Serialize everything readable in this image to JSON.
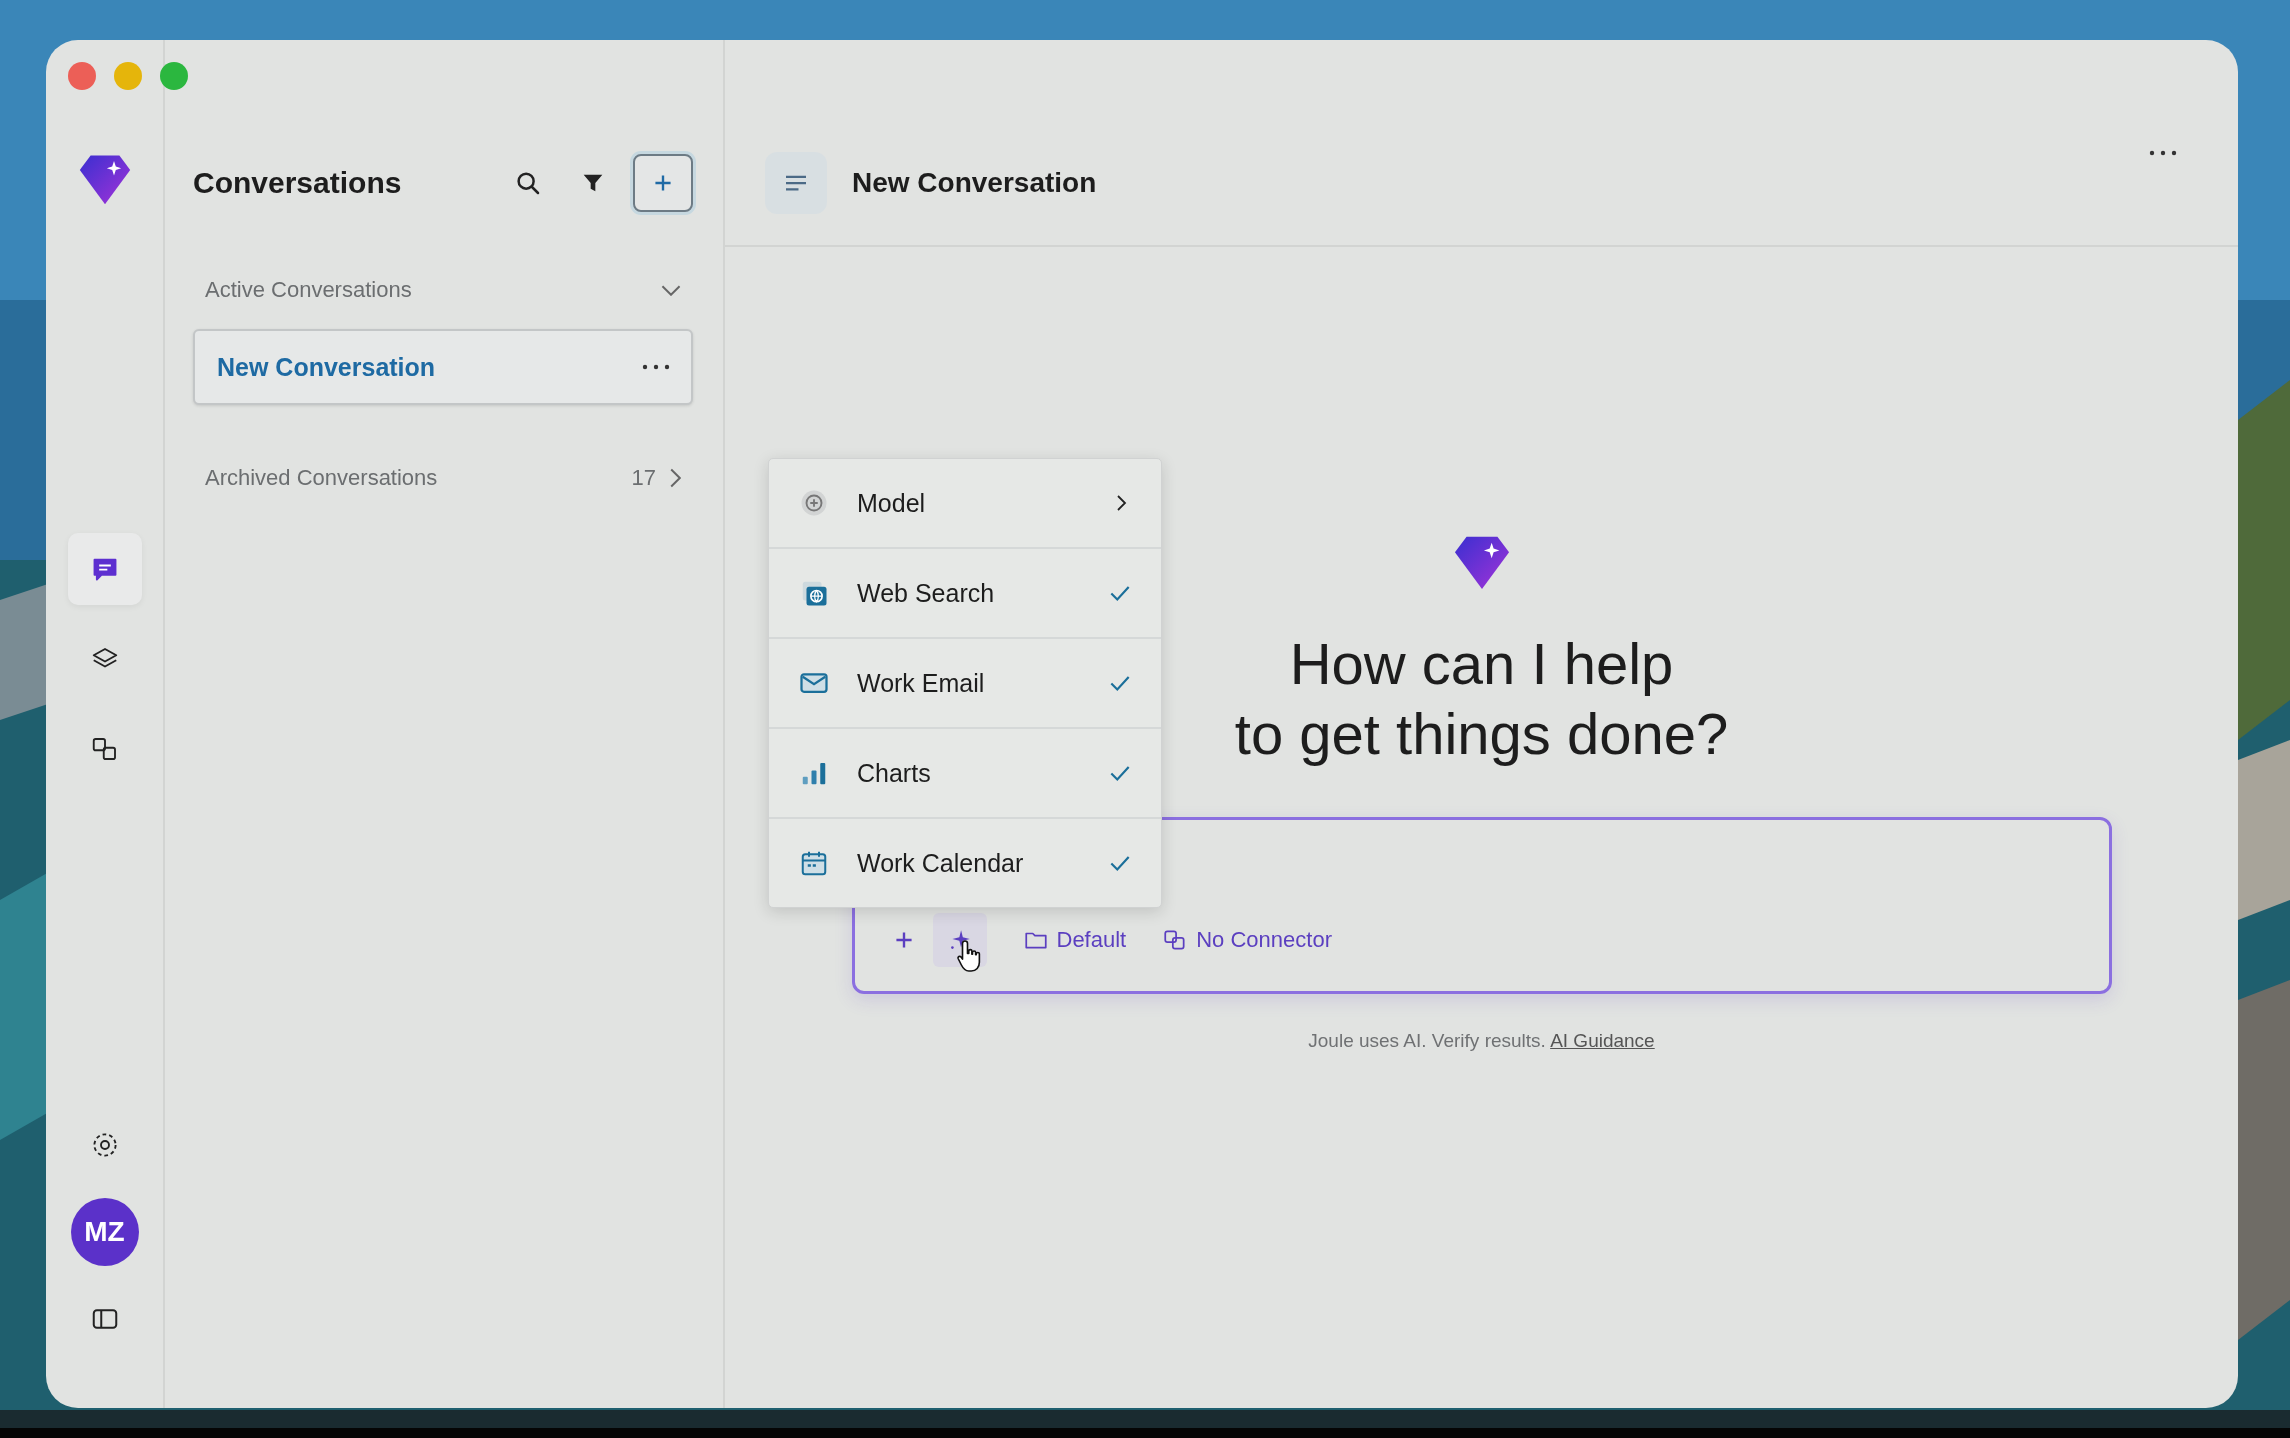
{
  "rail": {
    "items": [
      {
        "selected": true
      },
      {
        "selected": false
      },
      {
        "selected": false
      }
    ],
    "avatar": "MZ"
  },
  "conversations": {
    "title": "Conversations",
    "active_section": {
      "label": "Active Conversations",
      "expanded": true
    },
    "items": [
      {
        "title": "New Conversation",
        "selected": true
      }
    ],
    "archived_section": {
      "label": "Archived Conversations",
      "count": "17",
      "expanded": false
    }
  },
  "main": {
    "title": "New Conversation",
    "heading": [
      "How can I help",
      "to get things done?"
    ],
    "menu": [
      {
        "label": "Model",
        "kind": "submenu"
      },
      {
        "label": "Web Search",
        "kind": "toggle",
        "checked": true
      },
      {
        "label": "Work Email",
        "kind": "toggle",
        "checked": true
      },
      {
        "label": "Charts",
        "kind": "toggle",
        "checked": true
      },
      {
        "label": "Work Calendar",
        "kind": "toggle",
        "checked": true
      }
    ],
    "input": {
      "folder": "Default",
      "connector": "No Connector"
    },
    "footer": {
      "text": "Joule uses AI. Verify results.",
      "link": "AI Guidance"
    }
  }
}
